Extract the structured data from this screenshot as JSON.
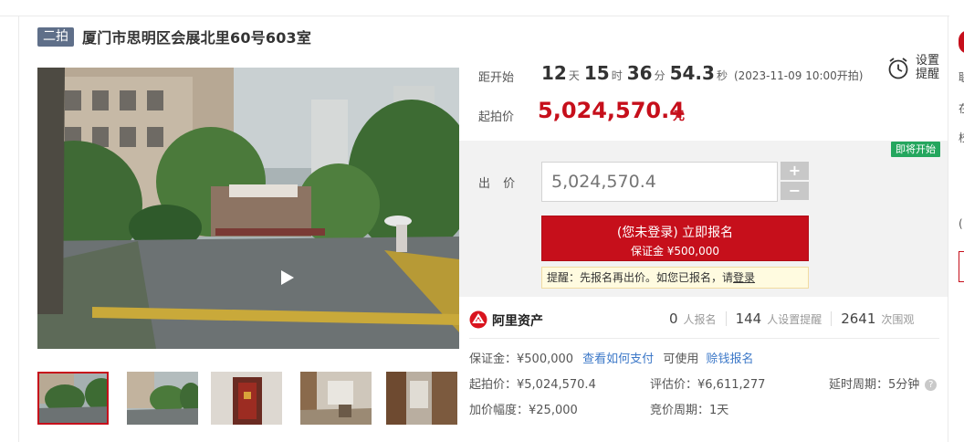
{
  "listing": {
    "round_badge": "二拍",
    "title": "厦门市思明区会展北里60号603室"
  },
  "countdown": {
    "label": "距开始",
    "days": "12",
    "days_unit": "天",
    "hours": "15",
    "hours_unit": "时",
    "minutes": "36",
    "minutes_unit": "分",
    "seconds": "54.3",
    "seconds_unit": "秒",
    "start_time": "(2023-11-09 10:00开拍)"
  },
  "reminder": {
    "line1": "设置",
    "line2": "提醒",
    "icon": "alarm-clock-icon"
  },
  "starting_price": {
    "label": "起拍价",
    "value": "5,024,570.4",
    "unit": "元"
  },
  "bid": {
    "status_badge": "即将开始",
    "label": "出 价",
    "input_placeholder": "5,024,570.4",
    "plus": "+",
    "minus": "−",
    "register_line1": "(您未登录) 立即报名",
    "register_line2": "保证金 ¥500,000",
    "tip_prefix": "提醒：先报名再出价。如您已报名，请",
    "tip_link": "登录"
  },
  "platform": {
    "name": "阿里资产",
    "icon": "ali-assets-logo-icon"
  },
  "stats": {
    "signups": "0",
    "signups_label": "人报名",
    "reminders": "144",
    "reminders_label": "人设置提醒",
    "views": "2641",
    "views_label": "次围观"
  },
  "details": {
    "deposit_label": "保证金：¥500,000",
    "how_to_pay": "查看如何支付",
    "loan_prefix": "可使用",
    "loan_link": "赊钱报名",
    "start_price": "起拍价：¥5,024,570.4",
    "appraisal": "评估价：¥6,611,277",
    "extension": "延时周期：5分钟",
    "increment": "加价幅度：¥25,000",
    "auction_cycle": "竞价周期：1天"
  },
  "edge_text": [
    "联",
    "在",
    "校",
    "("
  ],
  "colors": {
    "accent_red": "#c60f1b",
    "badge_green": "#24a65e",
    "badge_slate": "#5f6f89",
    "link_blue": "#3c78c8"
  }
}
